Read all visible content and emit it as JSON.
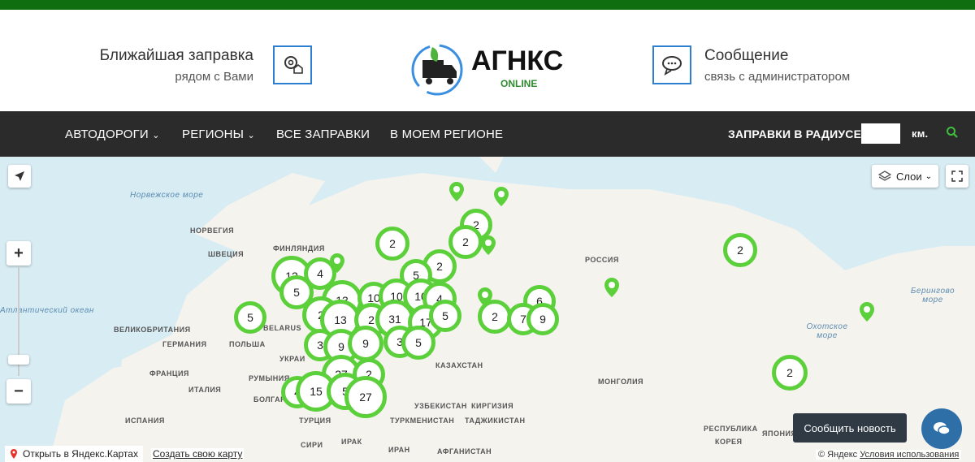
{
  "header": {
    "nearest": {
      "title": "Ближайшая заправка",
      "subtitle": "рядом с Вами"
    },
    "logo": {
      "main": "АГНКС",
      "sub": "ONLINE"
    },
    "message": {
      "title": "Сообщение",
      "subtitle": "связь с администратором"
    }
  },
  "nav": {
    "items": [
      {
        "label": "АВТОДОРОГИ",
        "dropdown": true
      },
      {
        "label": "РЕГИОНЫ",
        "dropdown": true
      },
      {
        "label": "ВСЕ ЗАПРАВКИ",
        "dropdown": false
      },
      {
        "label": "В МОЕМ РЕГИОНЕ",
        "dropdown": false
      }
    ],
    "radius_label": "ЗАПРАВКИ В РАДИУСЕ",
    "radius_value": "",
    "radius_unit": "км."
  },
  "map": {
    "layers_label": "Слои",
    "open_in_yandex": "Открыть в Яндекс.Картах",
    "create_map": "Создать свою карту",
    "copyright": "© Яндекс",
    "terms": "Условия использования",
    "labels": {
      "norwegian_sea": "Норвежское море",
      "atlantic": "Атлантический океан",
      "norway": "НОРВЕГИЯ",
      "sweden": "ШВЕЦИЯ",
      "finland": "ФИНЛЯНДИЯ",
      "uk": "ВЕЛИКОБРИТАНИЯ",
      "germany": "ГЕРМАНИЯ",
      "poland": "ПОЛЬША",
      "belarus": "BELARUS",
      "ukraine": "УКРАИ",
      "france": "ФРАНЦИЯ",
      "romania": "РУМЫНИЯ",
      "italy": "ИТАЛИЯ",
      "bulgaria": "БОЛГАРИ",
      "spain": "ИСПАНИЯ",
      "turkey": "ТУРЦИЯ",
      "syria": "СИРИ",
      "iraq": "ИРАК",
      "iran": "ИРАН",
      "afghanistan": "АФГАНИСТАН",
      "kazakhstan": "КАЗАХСТАН",
      "uzbekistan": "УЗБЕКИСТАН",
      "kyrgyzstan": "КИРГИЗИЯ",
      "turkmenistan": "ТУРКМЕНИСТАН",
      "tajikistan": "ТАДЖИКИСТАН",
      "russia": "РОССИЯ",
      "mongolia": "МОНГОЛИЯ",
      "okhotsk": "Охотское море",
      "bering": "Берингово море",
      "korea": "КОРЕЯ",
      "japan": "ЯПОНИЯ",
      "korea_s": "РЕСПУБЛИКА"
    },
    "clusters": [
      "2",
      "2",
      "2",
      "2",
      "2",
      "13",
      "4",
      "5",
      "5",
      "13",
      "13",
      "2",
      "31",
      "17",
      "5",
      "3",
      "9",
      "9",
      "3",
      "5",
      "27",
      "2",
      "15",
      "5",
      "27",
      "2",
      "7",
      "9",
      "6",
      "2",
      "2",
      "2",
      "12",
      "5",
      "10",
      "4",
      "10"
    ]
  },
  "news_button": {
    "label": "Сообщить новость"
  }
}
